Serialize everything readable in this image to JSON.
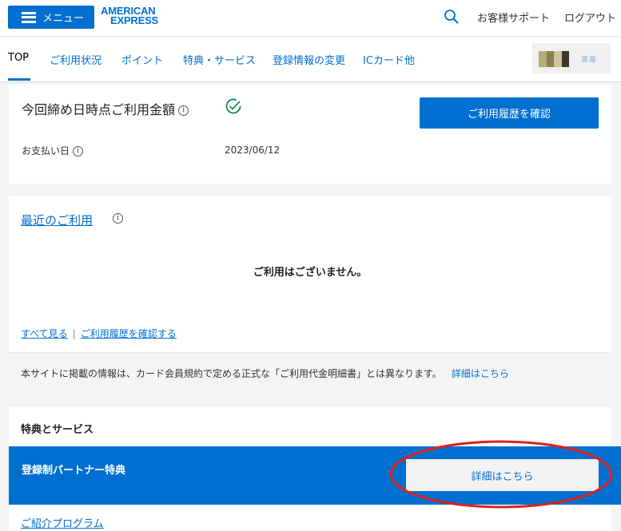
{
  "header": {
    "menu_label": "メニュー",
    "logo_line1": "AMERICAN",
    "logo_line2": "EXPRESS",
    "support_label": "お客様サポート",
    "logout_label": "ログアウト"
  },
  "nav": {
    "items": [
      {
        "label": "TOP",
        "active": true
      },
      {
        "label": "ご利用状況"
      },
      {
        "label": "ポイント"
      },
      {
        "label": "特典・サービス"
      },
      {
        "label": "登録情報の変更"
      },
      {
        "label": "ICカード他"
      }
    ]
  },
  "summary": {
    "title": "今回締め日時点ご利用金額",
    "history_button": "ご利用履歴を確認",
    "payment_label": "お支払い日",
    "payment_date": "2023/06/12"
  },
  "recent": {
    "title": "最近のご利用",
    "empty_message": "ご利用はございません。",
    "see_all": "すべて見る",
    "separator": "|",
    "check_history": "ご利用履歴を確認する",
    "notice": "本サイトに掲載の情報は、カード会員規約で定める正式な「ご利用代金明細書」とは異なります。",
    "notice_link": "詳細はこちら"
  },
  "benefits": {
    "title": "特典とサービス",
    "partner_label": "登録制パートナー特典",
    "detail_button": "詳細はこちら",
    "referral": "ご紹介プログラム"
  },
  "colors": {
    "brand_blue": "#006fcf",
    "highlight_red": "#e0201c",
    "success_green": "#1a8a5a"
  },
  "icons": [
    "menu-icon",
    "search-icon",
    "info-icon",
    "check-circle-icon"
  ]
}
